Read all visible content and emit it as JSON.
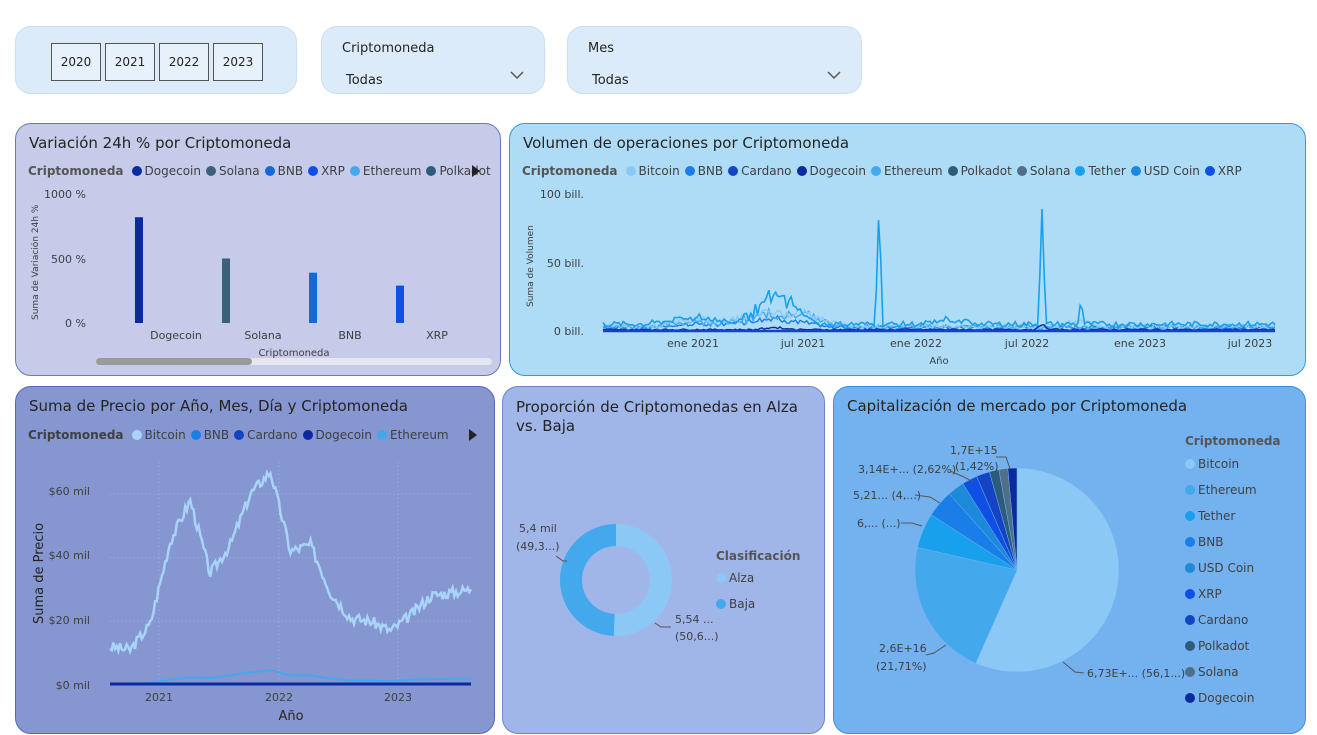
{
  "filters": {
    "years": [
      "2020",
      "2021",
      "2022",
      "2023"
    ],
    "crypto": {
      "label": "Criptomoneda",
      "value": "Todas"
    },
    "month": {
      "label": "Mes",
      "value": "Todas"
    }
  },
  "variation": {
    "title": "Variación 24h % por Criptomoneda",
    "legend_title": "Criptomoneda",
    "legend": [
      {
        "name": "Dogecoin",
        "color": "#0b2a9e"
      },
      {
        "name": "Solana",
        "color": "#3c5f7c"
      },
      {
        "name": "BNB",
        "color": "#1468d8"
      },
      {
        "name": "XRP",
        "color": "#0f4fe6"
      },
      {
        "name": "Ethereum",
        "color": "#43a8ec"
      },
      {
        "name": "Polkadot",
        "color": "#2d5c7a"
      }
    ],
    "ylabel": "Suma de Variación 24h %",
    "yticks": [
      "1000 %",
      "500 %",
      "0 %"
    ],
    "xlabel": "Criptomoneda",
    "chart_data": {
      "type": "bar",
      "categories": [
        "Dogecoin",
        "Solana",
        "BNB",
        "XRP"
      ],
      "values": [
        820,
        500,
        390,
        290
      ],
      "ylabel": "Suma de Variación 24h %",
      "xlabel": "Criptomoneda",
      "ylim": [
        0,
        1000
      ],
      "colors": [
        "#0b2a9e",
        "#3c5f7c",
        "#1468d8",
        "#0f4fe6"
      ]
    }
  },
  "volume": {
    "title": "Volumen de operaciones por Criptomoneda",
    "legend_title": "Criptomoneda",
    "legend": [
      {
        "name": "Bitcoin",
        "color": "#8cc8f5"
      },
      {
        "name": "BNB",
        "color": "#1a7ee8"
      },
      {
        "name": "Cardano",
        "color": "#1444c4"
      },
      {
        "name": "Dogecoin",
        "color": "#0b2a9e"
      },
      {
        "name": "Ethereum",
        "color": "#43a8ec"
      },
      {
        "name": "Polkadot",
        "color": "#2d5c7a"
      },
      {
        "name": "Solana",
        "color": "#4f6f88"
      },
      {
        "name": "Tether",
        "color": "#18a0ec"
      },
      {
        "name": "USD Coin",
        "color": "#1c8ad8"
      },
      {
        "name": "XRP",
        "color": "#0f4fe6"
      }
    ],
    "ylabel": "Suma de Volumen",
    "yticks": [
      "100 bill.",
      "50 bill.",
      "0 bill."
    ],
    "xticks": [
      "ene 2021",
      "jul 2021",
      "ene 2022",
      "jul 2022",
      "ene 2023",
      "jul 2023"
    ],
    "xlabel": "Año",
    "chart_data": {
      "type": "line",
      "x": [
        "ene 2021",
        "jul 2021",
        "ene 2022",
        "jul 2022",
        "ene 2023",
        "jul 2023"
      ],
      "series": [
        {
          "name": "Tether",
          "values": [
            5,
            15,
            4,
            6,
            4,
            3
          ],
          "peaks": [
            {
              "date": "nov 2021",
              "value": 92
            },
            {
              "date": "jun 2022",
              "value": 90
            }
          ]
        },
        {
          "name": "Bitcoin",
          "values": [
            3,
            8,
            3,
            2,
            1,
            1
          ]
        },
        {
          "name": "Ethereum",
          "values": [
            2,
            6,
            2,
            2,
            1,
            1
          ]
        }
      ],
      "ylabel": "Suma de Volumen",
      "xlabel": "Año",
      "ylim": [
        0,
        100
      ]
    }
  },
  "price": {
    "title": "Suma de Precio por Año, Mes, Día y Criptomoneda",
    "legend_title": "Criptomoneda",
    "legend": [
      {
        "name": "Bitcoin",
        "color": "#a8d4f8"
      },
      {
        "name": "BNB",
        "color": "#1a7ee8"
      },
      {
        "name": "Cardano",
        "color": "#1444c4"
      },
      {
        "name": "Dogecoin",
        "color": "#0b2a9e"
      },
      {
        "name": "Ethereum",
        "color": "#43a8ec"
      }
    ],
    "ylabel": "Suma de Precio",
    "yticks": [
      "$60 mil",
      "$40 mil",
      "$20 mil",
      "$0 mil"
    ],
    "xticks": [
      "2021",
      "2022",
      "2023"
    ],
    "xlabel": "Año",
    "chart_data": {
      "type": "line",
      "x": [
        "2020-08",
        "2020-10",
        "2020-12",
        "2021-02",
        "2021-04",
        "2021-06",
        "2021-08",
        "2021-10",
        "2021-11",
        "2022-01",
        "2022-03",
        "2022-05",
        "2022-07",
        "2022-09",
        "2022-11",
        "2023-01",
        "2023-03",
        "2023-05",
        "2023-07"
      ],
      "series": [
        {
          "name": "Bitcoin",
          "values": [
            12,
            11,
            19,
            45,
            58,
            35,
            44,
            60,
            67,
            42,
            44,
            29,
            21,
            20,
            17,
            22,
            28,
            29,
            30
          ]
        },
        {
          "name": "Ethereum",
          "values": [
            0.4,
            0.4,
            0.7,
            1.6,
            2.4,
            2.2,
            3,
            4,
            4.6,
            3,
            3,
            2,
            1.4,
            1.4,
            1.2,
            1.6,
            1.8,
            1.9,
            1.9
          ]
        }
      ],
      "ylabel": "Suma de Precio",
      "xlabel": "Año",
      "ylim": [
        0,
        70
      ]
    }
  },
  "proportion": {
    "title1": "Proporción de Criptomonedas en Alza",
    "title2": "vs. Baja",
    "legend_title": "Clasificación",
    "legend": [
      {
        "name": "Alza",
        "color": "#8cc8f5"
      },
      {
        "name": "Baja",
        "color": "#43a8ec"
      }
    ],
    "label_top1": "5,4 mil",
    "label_top2": "(49,3...)",
    "label_bot1": "5,54 ...",
    "label_bot2": "(50,6...)",
    "chart_data": {
      "type": "pie",
      "categories": [
        "Alza",
        "Baja"
      ],
      "values": [
        5540,
        5400
      ],
      "percent": [
        50.6,
        49.3
      ]
    }
  },
  "marketcap": {
    "title": "Capitalización de mercado por Criptomoneda",
    "legend_title": "Criptomoneda",
    "legend": [
      {
        "name": "Bitcoin",
        "color": "#8cc8f5"
      },
      {
        "name": "Ethereum",
        "color": "#43a8ec"
      },
      {
        "name": "Tether",
        "color": "#18a0ec"
      },
      {
        "name": "BNB",
        "color": "#1a7ee8"
      },
      {
        "name": "USD Coin",
        "color": "#1c8ad8"
      },
      {
        "name": "XRP",
        "color": "#0f4fe6"
      },
      {
        "name": "Cardano",
        "color": "#1444c4"
      },
      {
        "name": "Polkadot",
        "color": "#2d5c7a"
      },
      {
        "name": "Solana",
        "color": "#4f6f88"
      },
      {
        "name": "Dogecoin",
        "color": "#0b2a9e"
      }
    ],
    "labels": {
      "bitcoin": "6,73E+... (56,1...)",
      "ethereum1": "2,6E+16",
      "ethereum2": "(21,71%)",
      "tether": "6,... (...)",
      "bnb": "5,21... (4,...)",
      "usdc": "3,14E+... (2,62%)",
      "top1": "1,7E+15",
      "top2": "(1,42%)"
    },
    "chart_data": {
      "type": "pie",
      "categories": [
        "Bitcoin",
        "Ethereum",
        "Tether",
        "BNB",
        "USD Coin",
        "XRP",
        "Cardano",
        "Polkadot",
        "Solana",
        "Dogecoin"
      ],
      "percent": [
        56.1,
        21.71,
        5.5,
        4.3,
        2.62,
        2.4,
        2.1,
        1.5,
        1.4,
        1.42
      ]
    }
  }
}
